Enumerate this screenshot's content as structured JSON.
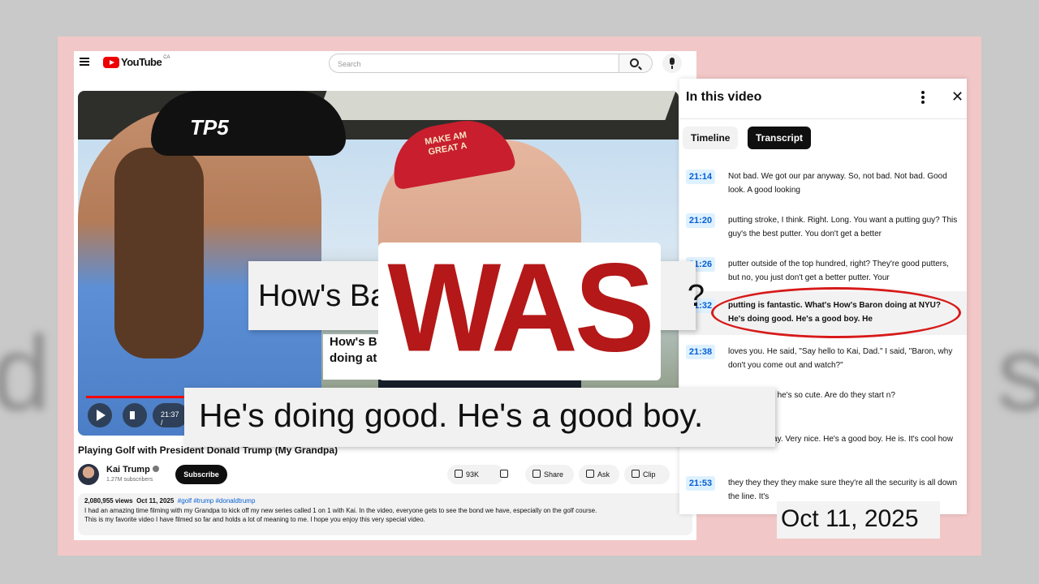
{
  "youtube": {
    "logo_text": "YouTube",
    "country_code": "CA",
    "search_placeholder": "Search",
    "video": {
      "current_time": "21:37 /"
    },
    "video_inner_caption": [
      "How's B",
      "doing at"
    ],
    "video_title": "Playing Golf with President Donald Trump (My Grandpa)",
    "channel": {
      "name": "Kai Trump",
      "subscribers": "1.27M subscribers",
      "subscribe_label": "Subscribe"
    },
    "actions": {
      "likes": "93K",
      "share": "Share",
      "ask": "Ask",
      "clip": "Clip"
    },
    "description": {
      "views": "2,080,955 views",
      "date": "Oct 11, 2025",
      "tags": "#golf #trump #donaldtrump",
      "lines": [
        "I had an amazing time filming with my Grandpa to kick off my new series called 1 on 1 with Kai. In the video, everyone gets to see the bond we have, especially on the golf course.",
        "This is my favorite video I have filmed so far and holds a lot of meaning to me. I hope you enjoy this very special video."
      ]
    }
  },
  "panel": {
    "title": "In this video",
    "tabs": [
      "Timeline",
      "Transcript"
    ],
    "active_tab": "Transcript",
    "segments": [
      {
        "time": "21:14",
        "text": "Not bad. We got our par anyway. So, not bad. Not bad. Good look. A good looking"
      },
      {
        "time": "21:20",
        "text": "putting stroke, I think. Right. Long. You want a putting guy? This guy's the best putter. You don't get a better"
      },
      {
        "time": "21:26",
        "text": "putter outside of the top hundred, right? They're good putters, but no, you just don't get a better putter. Your"
      },
      {
        "time": "21:32",
        "text": "putting is fantastic. What's How's Baron doing at NYU? He's doing good. He's a good boy. He"
      },
      {
        "time": "21:38",
        "text": "loves you. He said, \"Say hello to Kai, Dad.\" I said, \"Baron, why don't you come out and watch?\""
      },
      {
        "time": "",
        "text": "id, you know, he's so cute. Are do they start n?"
      },
      {
        "time": "",
        "text": "rts on Tuesday. Very nice. He's a good boy. He is. It's cool how"
      },
      {
        "time": "21:53",
        "text": "they they they they make sure they're all the security is all down the line. It's"
      }
    ]
  },
  "overlays": {
    "caption_upper": "How's Ba                                   ?",
    "caption_lower": "He's doing good. He's a good boy.",
    "stamp": "WAS",
    "date_label": "Oct 11, 2025"
  },
  "colors": {
    "accent_red": "#b41818",
    "frame_pink": "#f2c7c7",
    "timestamp_blue": "#065fd4",
    "highlight_circle": "#d71a1a"
  }
}
